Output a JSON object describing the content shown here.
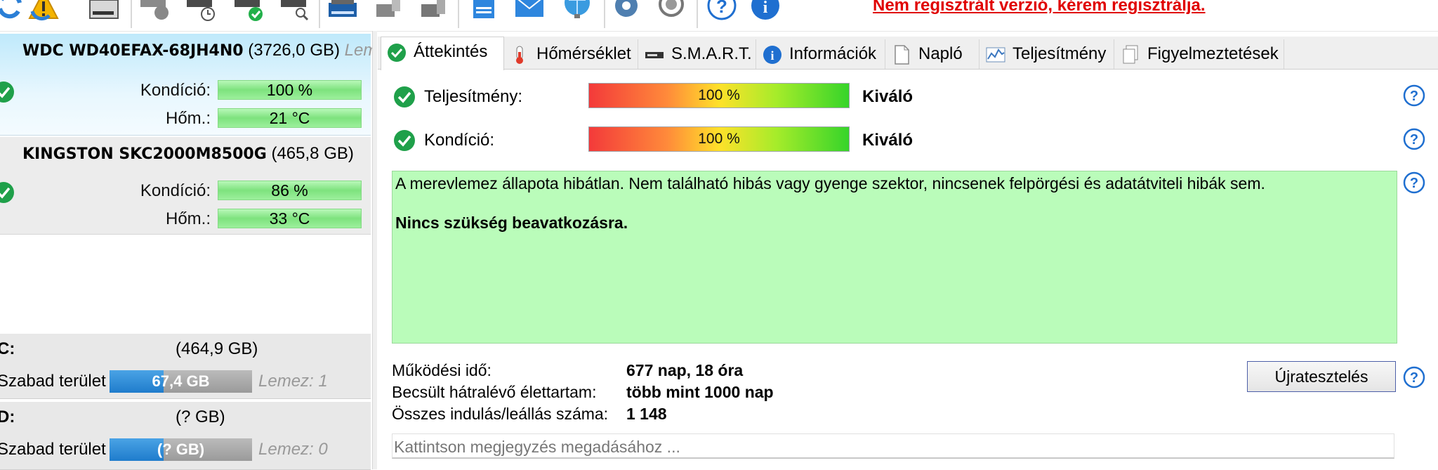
{
  "toolbar": {
    "icons": [
      "refresh-icon",
      "warning-icon",
      "drive-icon",
      "drive-gauge-icon",
      "drive-clock-icon",
      "drive-check-icon",
      "drive-search-icon",
      "drive-scan-icon",
      "drive-tools-icon",
      "drive-flash-icon",
      "notebook-icon",
      "mail-icon",
      "globe-icon",
      "gear-icon",
      "speaker-icon",
      "help-icon",
      "info-icon"
    ],
    "unregistered_notice": "Nem regisztrált verzió, kérem regisztrálja."
  },
  "disks": [
    {
      "name": "WDC WD40EFAX-68JH4N0",
      "size": "(3726,0 GB)",
      "extra": "Lem",
      "health_label": "Kondíció:",
      "health_value": "100 %",
      "temp_label": "Hőm.:",
      "temp_value": "21 °C"
    },
    {
      "name": "KINGSTON SKC2000M8500G",
      "size": "(465,8 GB)",
      "health_label": "Kondíció:",
      "health_value": "86 %",
      "temp_label": "Hőm.:",
      "temp_value": "33 °C"
    }
  ],
  "volumes": [
    {
      "letter": "C:",
      "size": "(464,9 GB)",
      "free_label": "Szabad terület",
      "free_value": "67,4 GB",
      "free_fraction": 0.38,
      "disk": "Lemez: 1"
    },
    {
      "letter": "D:",
      "size": "(? GB)",
      "free_label": "Szabad terület",
      "free_value": "(? GB)",
      "free_fraction": 0.38,
      "disk": "Lemez: 0"
    }
  ],
  "tabs": [
    {
      "label": "Áttekintés",
      "icon": "check-circle-icon",
      "active": true
    },
    {
      "label": "Hőmérséklet",
      "icon": "thermometer-icon"
    },
    {
      "label": "S.M.A.R.T.",
      "icon": "drive-icon"
    },
    {
      "label": "Információk",
      "icon": "info-icon"
    },
    {
      "label": "Napló",
      "icon": "document-icon"
    },
    {
      "label": "Teljesítmény",
      "icon": "chart-icon"
    },
    {
      "label": "Figyelmeztetések",
      "icon": "documents-icon"
    }
  ],
  "overview": {
    "performance": {
      "label": "Teljesítmény:",
      "value": "100 %",
      "quality": "Kiváló",
      "percent": 100
    },
    "health": {
      "label": "Kondíció:",
      "value": "100 %",
      "quality": "Kiváló",
      "percent": 100
    },
    "status_text": "A merevlemez állapota hibátlan. Nem található hibás vagy gyenge szektor, nincsenek felpörgési és adatátviteli hibák sem.",
    "status_action": "Nincs szükség beavatkozásra.",
    "status_color": "#bafcba",
    "power_on_label": "Működési idő:",
    "power_on_value": "677 nap, 18 óra",
    "lifetime_label": "Becsült hátralévő élettartam:",
    "lifetime_value": "több mint 1000 nap",
    "start_stop_label": "Összes indulás/leállás száma:",
    "start_stop_value": "1 148",
    "retest_label": "Újratesztelés",
    "note_placeholder": "Kattintson megjegyzés megadásához ..."
  },
  "colors": {
    "accent": "#1f7ccc",
    "unregistered": "#e00000",
    "ok_green": "#22b04a"
  }
}
